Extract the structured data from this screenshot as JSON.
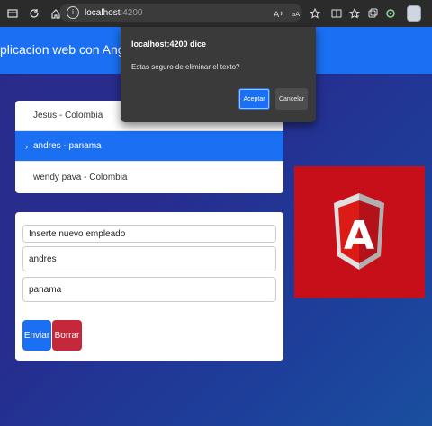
{
  "browser": {
    "url_host": "localhost",
    "url_port": ":4200",
    "info_icon": "i",
    "nav_icons": [
      "window-menu-icon",
      "refresh-icon",
      "home-icon"
    ],
    "toolbar_icons": [
      "read-aloud-icon",
      "translate-icon",
      "favorite-star-icon",
      "split-screen-icon",
      "favorites-icon",
      "collections-icon",
      "extensions-icon",
      "profile-icon",
      "more-icon"
    ]
  },
  "app": {
    "brand": "plicacion web con Angular"
  },
  "employees": {
    "items": [
      {
        "label": "Jesus - Colombia",
        "active": false
      },
      {
        "label": "andres - panama",
        "active": true
      },
      {
        "label": "wendy pava - Colombia",
        "active": false
      }
    ],
    "active_marker": "›"
  },
  "form": {
    "header_value": "Inserte nuevo empleado",
    "name_value": "andres",
    "country_value": "panama",
    "submit_label": "Enviar",
    "delete_label": "Borrar"
  },
  "logo": {
    "name": "angular-logo",
    "letter": "A",
    "colors": {
      "background": "#c70f1a",
      "shield_light": "#e0e0e0",
      "shield_dark": "#b0b0b0",
      "letter": "#dd1b16"
    }
  },
  "dialog": {
    "title": "localhost:4200 dice",
    "message": "Estas seguro de eliminar el texto?",
    "ok_label": "Aceptar",
    "cancel_label": "Cancelar"
  },
  "colors": {
    "primary": "#1b6ff2",
    "danger": "#c4283a",
    "dialog_bg": "#3a3a3a"
  }
}
